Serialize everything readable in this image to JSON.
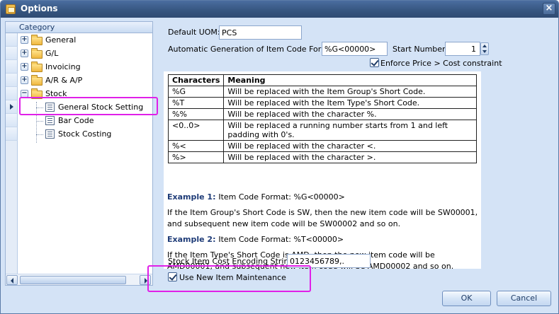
{
  "window": {
    "title": "Options",
    "close_glyph": "×"
  },
  "sidebar": {
    "header": "Category",
    "items": [
      {
        "label": "General",
        "type": "folder",
        "expander": "+"
      },
      {
        "label": "G/L",
        "type": "folder",
        "expander": "+"
      },
      {
        "label": "Invoicing",
        "type": "folder",
        "expander": "+"
      },
      {
        "label": "A/R & A/P",
        "type": "folder",
        "expander": "+"
      },
      {
        "label": "Stock",
        "type": "folder",
        "expander": "−"
      },
      {
        "label": "General Stock Setting",
        "type": "page",
        "selected": true
      },
      {
        "label": "Bar Code",
        "type": "page"
      },
      {
        "label": "Stock Costing",
        "type": "page"
      }
    ]
  },
  "form": {
    "default_uom_label": "Default UOM:",
    "default_uom_value": "PCS",
    "auto_gen_label": "Automatic Generation of Item Code Forma",
    "auto_gen_value": "%G<00000>",
    "start_number_label": "Start Number:",
    "start_number_value": "1",
    "enforce_label": "Enforce Price > Cost constraint",
    "enforce_checked": true,
    "cost_encoding_label": "Stock Item Cost Encoding String:",
    "cost_encoding_value": "0123456789,.",
    "use_new_item_label": "Use New Item Maintenance",
    "use_new_item_checked": true
  },
  "table": {
    "headers": [
      "Characters",
      "Meaning"
    ],
    "rows": [
      [
        "%G",
        "Will be replaced with the Item Group's Short Code."
      ],
      [
        "%T",
        "Will be replaced with the Item Type's Short Code."
      ],
      [
        "%%",
        "Will be replaced with the character %."
      ],
      [
        "<0..0>",
        "Will be replaced a running number starts from 1 and left padding with 0's."
      ],
      [
        "%<",
        "Will be replaced with the character <."
      ],
      [
        "%>",
        "Will be replaced with the character >."
      ]
    ]
  },
  "examples": [
    {
      "title": "Example 1:",
      "format": "Item Code Format: %G<00000>",
      "text": "If the Item Group's Short Code is SW, then the new item code will be SW00001, and subsequent new item code will be SW00002 and so on."
    },
    {
      "title": "Example 2:",
      "format": "Item Code Format: %T<00000>",
      "text": "If the Item Type's Short Code is AMD, then the new item code will be AMD00001, and subsequent new item code will be AMD00002 and so on."
    }
  ],
  "buttons": {
    "ok": "OK",
    "cancel": "Cancel"
  },
  "colors": {
    "highlight": "#e020e8",
    "example_title": "#1f3c78",
    "title_bar": "#36557f"
  }
}
